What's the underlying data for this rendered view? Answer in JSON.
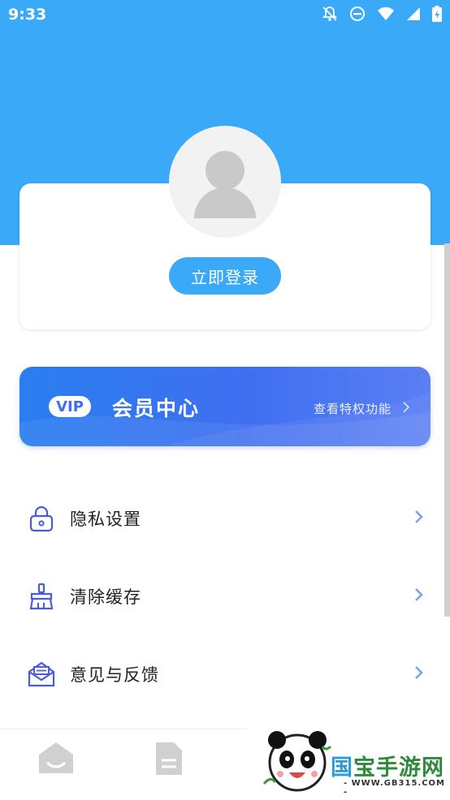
{
  "status_bar": {
    "time": "9:33"
  },
  "profile": {
    "login_label": "立即登录"
  },
  "vip": {
    "badge": "VIP",
    "title": "会员中心",
    "link": "查看特权功能"
  },
  "menu": [
    {
      "label": "隐私设置",
      "icon": "lock-icon"
    },
    {
      "label": "清除缓存",
      "icon": "broom-icon"
    },
    {
      "label": "意见与反馈",
      "icon": "mail-icon"
    }
  ],
  "tabs": [
    {
      "icon": "home-icon"
    },
    {
      "icon": "document-icon"
    }
  ],
  "watermark": {
    "title_a": "国",
    "title_b": "宝手游网",
    "url": "- WWW.GB315.COM -"
  },
  "colors": {
    "primary": "#3aa9f7",
    "vip": "#3f6ff0",
    "menu_icon": "#4a5be0"
  }
}
